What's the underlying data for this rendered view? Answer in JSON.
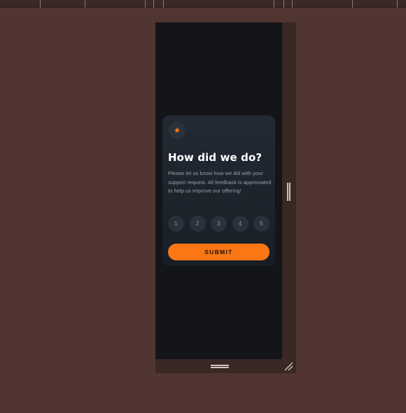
{
  "card": {
    "title": "How did we do?",
    "description": "Please let us know how we did with your support request. All feedback is appreciated to help us improve our offering!",
    "star_icon": "star-icon",
    "ratings": [
      "1",
      "2",
      "3",
      "4",
      "5"
    ],
    "submit_label": "SUBMIT"
  },
  "colors": {
    "page_background": "#513530",
    "viewport_background": "#131518",
    "card_background": "#232a34",
    "accent_orange": "#fc7614",
    "rating_circle": "#2a313a",
    "description_text": "#959eac"
  }
}
